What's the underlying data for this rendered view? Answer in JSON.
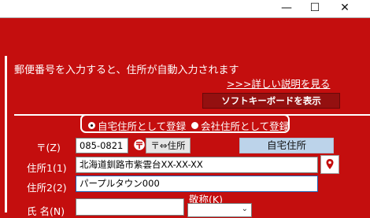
{
  "window": {
    "minimize_glyph": "—",
    "maximize_glyph": "☐",
    "close_glyph": "✕"
  },
  "header": {
    "instruction": "郵便番号を入力すると、住所が自動入力されます",
    "details_link": ">>>詳しい説明を見る",
    "soft_keyboard_button": "ソフトキーボードを表示"
  },
  "address_type": {
    "options": [
      {
        "label": "自宅住所として登録",
        "checked": true
      },
      {
        "label": "会社住所として登録",
        "checked": false
      }
    ]
  },
  "form": {
    "postal_label": "〒(Z)",
    "postal_value": "085-0821",
    "convert_button": "〒⇔住所",
    "address_type_display": "自宅住所",
    "address1_label": "住所1(1)",
    "address1_value": "北海道釧路市紫雲台XX-XX-XX",
    "address2_label": "住所2(2)",
    "address2_value": "パープルタウン000",
    "name_label": "氏 名(N)",
    "honorific_label": "敬称(K)",
    "map_pin_icon": "map-pin",
    "postmark_icon": "postal-mark"
  },
  "colors": {
    "background": "#c40e0e",
    "soft_keyboard_bg": "#941010",
    "display_button_bg": "#bcd3ea"
  }
}
